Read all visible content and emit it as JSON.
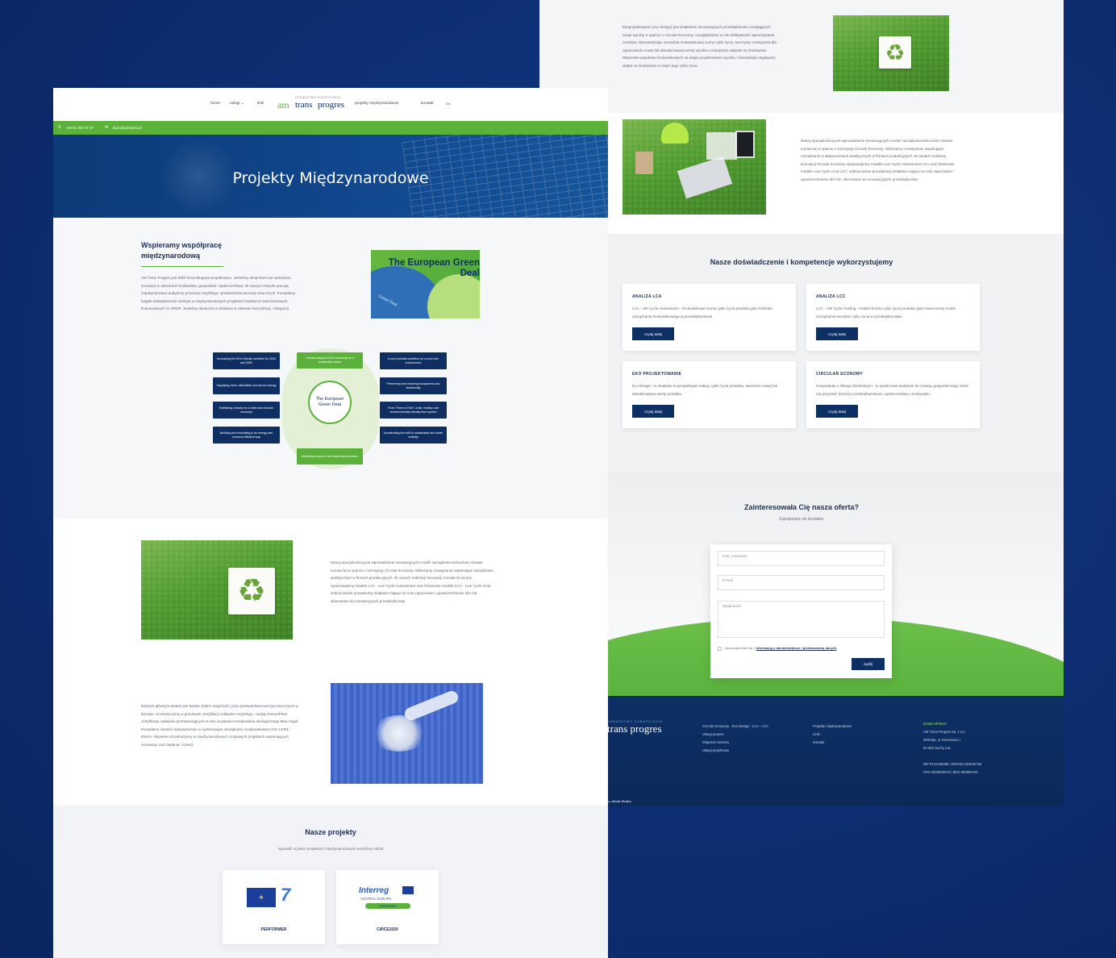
{
  "right": {
    "eco_text": "Ekoprojektowanie (eco design) jest działaniem innowacyjnych przedsiębiorstw rozwijających swoje wyroby w oparciu o Circular Economy. Uwzględniamy w nim efektywność wykorzystania zasobów. Wprowadzając narzędzia środowiskowej oceny cyklu życia, tworzymy rozwiązania dla opracowania nowej lub aktualizowanej wersji wyrobu o mniejszym wpływie na środowisko. Włączanie aspektów środowiskowych na etapie projektowania wyrobu, minimalizuje negatywny wpływ na środowisko w całym jego cyklu życia.",
    "cirk_text": "Naszą specjalnością jest wprowadzanie innowacyjnych modeli zarządzania łańcuchem dostaw surowców w oparciu o koncepcję Circular Economy. Wdrażamy rozwiązania, wspierające zarządzanie w aktywnościach analitycznych w firmach produkcyjnych. W ramach realizacji koncepcji Circular Economy opracowujemy modele Live Cycle Assessment LCA oraz finansowe modele Live Cycle Cost LCC. Jednocześnie prowadzimy działania mające na celu zapoznanie i upowszechnienie idei CE, skierowane do innowacyjnych przedsiębiorstw.",
    "competence_title": "Nasze doświadczenie i kompetencje wykorzystujemy",
    "cards": [
      {
        "title": "ANALIZA LCA",
        "text": "LCA - Life Cycle Assessment - Środowiskowa ocena cyklu życia produktu jako technika zarządzania środowiskowego w przedsiębiorstwie",
        "button": "czytaj dalej"
      },
      {
        "title": "ANALIZA LCC",
        "text": "LCC - Life Cycle Costing - Analiza kosztu cyklu życia produktu jako nowoczesny model zarządzania kosztami cyklu życia w przedsiębiorstwie",
        "button": "czytaj dalej"
      },
      {
        "title": "EKO PROJEKTOWANIE",
        "text": "Eco Design - to działanie w perspektywie całego cyklu życia produktu, tworzenie nowej lub aktualizowanej wersji produktu.",
        "button": "czytaj dalej"
      },
      {
        "title": "CIRCULAR ECONOMY",
        "text": "Gospodarka o Obiegu Zamkniętym - to systemowe podejście do rozwoju gospodarczego, które ma przynieść korzyści przedsiębiorstwom, społeczeństwu i środowisku.",
        "button": "czytaj dalej"
      }
    ],
    "contact": {
      "title": "Zainteresowała Cię nasza oferta?",
      "subtitle": "Zapraszamy do kontaktu.",
      "name_placeholder": "Imię i nazwisko",
      "email_placeholder": "E-mail",
      "message_placeholder": "Wiadomość",
      "consent_prefix": "zapoznałem/am się z ",
      "consent_link": "informacją o administratorze i przetwarzaniu danych",
      "submit": "wyślij"
    },
    "footer": {
      "logo_top": "DORADZTWO EUROPEJSKIE",
      "logo": "trans progres",
      "col1": [
        "Circular Economy - Eco Design - LCA - LCC",
        "Usługi prawne",
        "Wsparcie biznesu",
        "Usługi projektowe"
      ],
      "col2": [
        "Projekty międzynarodowe",
        "Linki",
        "Kontakt"
      ],
      "col3_title": "DANE SPÓŁKI",
      "col3": [
        "AM Trans Progres Sp. z o.o.",
        "Zbórska, ul. Krzemowa 1",
        "62-052 Suchy Las",
        "",
        "NIP 9721259386 | REGON 304040793",
        "KRS 0000600078 | BDO 000090752"
      ],
      "credit_prefix": "by ",
      "credit_name": "Alead Studio"
    }
  },
  "left": {
    "nav": {
      "items": [
        "home",
        "usługi",
        "linki"
      ],
      "usługi_caret": "⌄",
      "logo_top": "DORADZTWO EUROPEJSKIE",
      "logo_am": "am",
      "logo_trans": "trans",
      "logo_progres": "progres",
      "items_right": [
        "projekty międzynarodowe",
        "kontakt"
      ],
      "flag": "EN"
    },
    "contact_bar": {
      "phone": "+48 61 000 07 37",
      "email": "biuro@amtrans.pl"
    },
    "hero_title": "Projekty Międzynarodowe",
    "intro": {
      "heading": "Wspieramy współpracę międzynarodową",
      "text": "AM Trans Progres jest MŚP konsultingowo-projektowym. Jesteśmy ekspertami we wdrażaniu innowacji w obszarach środowiska, gospodarki i społeczeństwa. W naszym zespole pracują międzynarodowi audytorzy procesów recyklingu i przetwórstwa tworzyw sztucznych. Posiadamy bogate doświadczenie zdobyte w międzynarodowych projektach badawczo-wdrożeniowych finansowanych ze ŚRDP. Jesteśmy skuteczni w działaniu w zakresie komunikacji i integracji.",
      "image_text": "The European Green Deal",
      "image_caption": "Green Deal"
    },
    "diagram": {
      "center": "The European Green Deal",
      "left": [
        "Increasing the EU's Climate ambition for 2030 and 2050",
        "Supplying clean, affordable and secure energy",
        "Mobilising industry for a clean and circular economy",
        "Building and renovating in an energy and resource efficient way"
      ],
      "right": [
        "A zero pollution ambition for a toxic-free environment",
        "Preserving and restoring ecosystems and biodiversity",
        "From “Farm to Fork”: a fair, healthy and environmentally friendly food system",
        "Accelerating the shift to sustainable and smart mobility"
      ],
      "top": "Transforming the EU's economy for a sustainable future",
      "bottom": "Mobilising research and fostering innovation"
    },
    "section1_text": "Naszą specjalnością jest wprowadzanie innowacyjnych modeli zarządzania łańcuchem dostaw surowców w oparciu o koncepcję Circular Economy. Wdrażamy rozwiązania wspierające zarządzanie analitycznym w firmach produkcyjnych. W ramach realizacji koncepcji Circular Economy opracowujemy modele LCA - Live Cycle Assessment oraz finansowe modele LCC - Live Cycle Cost. Jednocześnie prowadzimy działania mające na celu zapoznanie i upowszechnienie idei CE, skierowane do innowacyjnych przedsiębiorstw.",
    "section2_text": "Naszym głównym atutem jest bardzo dobra znajomość rynku przetwórstwa tworzyw sztucznych w Europie. Uczestniczymy w procesach certyfikacji zakładów recyklingu - audyty EuCertPlast certyfikacja zakładów przetwarzających w celu uzyskania oznakowania ekologicznego Blue Angel. Posiadamy również doświadczenie w systemowym zarządzaniu środowiskowym ISO 14001 i EMAS. Aktywnie uczestniczymy w międzynarodowych i krajowych projektach wspierających innowacje oraz badania i rozwój.",
    "projects": {
      "title": "Nasze projekty",
      "subtitle": "Sprawdź w jakich projektach międzynarodowych wzięliśmy udział",
      "items": [
        {
          "name": "PERFORMER",
          "logo_note": "7"
        },
        {
          "name": "CIRCE2020",
          "logo_title": "Interreg",
          "logo_sub": "CENTRAL EUROPE",
          "logo_tag": "CIRCE2020"
        }
      ]
    }
  },
  "colors": {
    "navy": "#0d2f64",
    "green": "#5bb13a",
    "bg": "#0d2e72"
  }
}
